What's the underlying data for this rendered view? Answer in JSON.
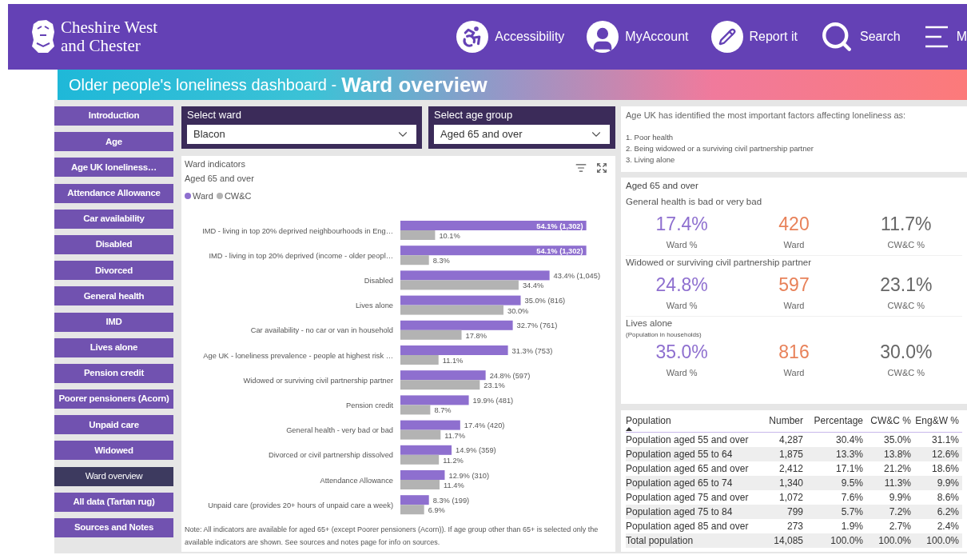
{
  "header": {
    "logo_lines": [
      "Cheshire West",
      "and Chester"
    ],
    "nav": [
      {
        "label": "Accessibility",
        "kind": "accessibility"
      },
      {
        "label": "MyAccount",
        "kind": "account"
      },
      {
        "label": "Report it",
        "kind": "report"
      },
      {
        "label": "Search",
        "kind": "search"
      },
      {
        "label": "M",
        "kind": "menu"
      }
    ]
  },
  "banner": {
    "title": "Older people's loneliness dashboard -",
    "page": "Ward overview"
  },
  "sidebar": {
    "items": [
      {
        "label": "Introduction",
        "selected": false
      },
      {
        "label": "Age",
        "selected": false
      },
      {
        "label": "Age UK loneliness…",
        "selected": false
      },
      {
        "label": "Attendance Allowance",
        "selected": false
      },
      {
        "label": "Car availability",
        "selected": false
      },
      {
        "label": "Disabled",
        "selected": false
      },
      {
        "label": "Divorced",
        "selected": false
      },
      {
        "label": "General health",
        "selected": false
      },
      {
        "label": "IMD",
        "selected": false
      },
      {
        "label": "Lives alone",
        "selected": false
      },
      {
        "label": "Pension credit",
        "selected": false
      },
      {
        "label": "Poorer pensioners (Acorn)",
        "selected": false
      },
      {
        "label": "Unpaid care",
        "selected": false
      },
      {
        "label": "Widowed",
        "selected": false
      },
      {
        "label": "Ward overview",
        "selected": true
      },
      {
        "label": "All data (Tartan rug)",
        "selected": false
      },
      {
        "label": "Sources and Notes",
        "selected": false
      }
    ]
  },
  "filters": [
    {
      "label": "Select ward",
      "value": "Blacon"
    },
    {
      "label": "Select age group",
      "value": "Aged 65 and over"
    }
  ],
  "chart_panel": {
    "title": "Ward indicators",
    "subtitle": "Aged 65 and over",
    "chart_data": {
      "type": "bar",
      "orientation": "horizontal",
      "categories": [
        "IMD - living in top 20% deprived neighbourhoods in Eng…",
        "IMD - living in top 20% deprived (income - older peopl…",
        "Disabled",
        "Lives alone",
        "Car availability - no car or van in household",
        "Age UK - loneliness prevalence - people at highest risk …",
        "Widowed or surviving civil partnership partner",
        "Pension credit",
        "General health - very bad or bad",
        "Divorced or civil partnership dissolved",
        "Attendance Allowance",
        "Unpaid care (provides 20+ hours of unpaid care a week)"
      ],
      "series": [
        {
          "name": "Ward",
          "color": "#8e6fcf",
          "values": [
            54.1,
            54.1,
            43.4,
            35.0,
            32.7,
            31.3,
            24.8,
            19.9,
            17.4,
            14.9,
            12.9,
            8.3
          ],
          "value_labels": [
            "54.1% (1,302)",
            "54.1% (1,302)",
            "43.4% (1,045)",
            "35.0% (816)",
            "32.7% (761)",
            "31.3% (753)",
            "24.8% (597)",
            "19.9% (481)",
            "17.4% (420)",
            "14.9% (359)",
            "12.9% (310)",
            "8.3% (199)"
          ]
        },
        {
          "name": "CW&C",
          "color": "#b3b3b3",
          "values": [
            10.1,
            8.3,
            34.4,
            30.0,
            17.8,
            11.1,
            23.1,
            8.7,
            11.7,
            11.2,
            11.4,
            6.9
          ],
          "value_labels": [
            "10.1%",
            "8.3%",
            "34.4%",
            "30.0%",
            "17.8%",
            "11.1%",
            "23.1%",
            "8.7%",
            "11.7%",
            "11.2%",
            "11.4%",
            "6.9%"
          ]
        }
      ]
    },
    "note": "Note: All indicators are available for aged 65+ (except Poorer pensioners (Acorn)).  If age group other than 65+ is selected only the available indicators are shown.  See sources and notes page for info on sources."
  },
  "factors": {
    "intro": "Age UK has identified the most important factors affecting loneliness as:",
    "items": [
      "1. Poor health",
      "2. Being widowed or a surviving civil partnership partner",
      "3. Living alone"
    ]
  },
  "kpis": {
    "heading": "Aged 65 and over",
    "groups": [
      {
        "title": "General health is bad or very bad",
        "metrics": [
          {
            "kind": "ward_pct",
            "value": "17.4%",
            "label": "Ward %"
          },
          {
            "kind": "ward_count",
            "value": "420",
            "label": "Ward"
          },
          {
            "kind": "area_pct",
            "value": "11.7%",
            "label": "CW&C %"
          }
        ]
      },
      {
        "title": "Widowed or surviving civil partnership partner",
        "metrics": [
          {
            "kind": "ward_pct",
            "value": "24.8%",
            "label": "Ward %"
          },
          {
            "kind": "ward_count",
            "value": "597",
            "label": "Ward"
          },
          {
            "kind": "area_pct",
            "value": "23.1%",
            "label": "CW&C %"
          }
        ]
      },
      {
        "title": "Lives alone",
        "note": "(Population in households)",
        "metrics": [
          {
            "kind": "ward_pct",
            "value": "35.0%",
            "label": "Ward %"
          },
          {
            "kind": "ward_count",
            "value": "816",
            "label": "Ward"
          },
          {
            "kind": "area_pct",
            "value": "30.0%",
            "label": "CW&C %"
          }
        ]
      }
    ]
  },
  "table": {
    "columns": [
      {
        "label": "Population",
        "sorted": true
      },
      {
        "label": "Number",
        "sorted": false
      },
      {
        "label": "Percentage",
        "sorted": false
      },
      {
        "label": "CW&C %",
        "sorted": false
      },
      {
        "label": "Eng&W %",
        "sorted": false
      }
    ],
    "rows": [
      [
        "Population aged 55 and over",
        "4,287",
        "30.4%",
        "35.0%",
        "31.1%"
      ],
      [
        "Population aged 55 to 64",
        "1,875",
        "13.3%",
        "13.8%",
        "12.6%"
      ],
      [
        "Population aged 65 and over",
        "2,412",
        "17.1%",
        "21.2%",
        "18.6%"
      ],
      [
        "Population aged 65 to 74",
        "1,340",
        "9.5%",
        "11.3%",
        "9.9%"
      ],
      [
        "Population aged 75 and over",
        "1,072",
        "7.6%",
        "9.9%",
        "8.6%"
      ],
      [
        "Population aged 75 to 84",
        "799",
        "5.7%",
        "7.2%",
        "6.2%"
      ],
      [
        "Population aged 85 and over",
        "273",
        "1.9%",
        "2.7%",
        "2.4%"
      ]
    ],
    "total": [
      "Total population",
      "14,085",
      "100.0%",
      "100.0%",
      "100.0%"
    ]
  }
}
